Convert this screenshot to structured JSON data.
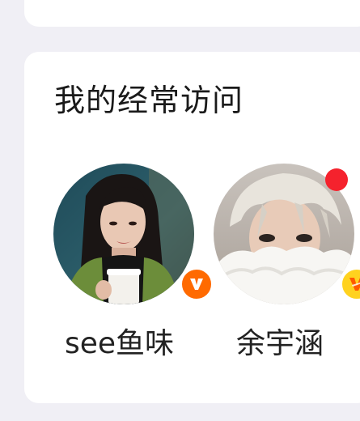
{
  "colors": {
    "page_bg": "#f0eff5",
    "card_bg": "#ffffff",
    "vip_orange": "#ff6a00",
    "vip_gold": "#ffd21f",
    "notification_red": "#f5222d"
  },
  "section": {
    "title": "我的经常访问",
    "items": [
      {
        "name": "see鱼味",
        "avatar": "avatar-woman-dark-hair-holding-cup",
        "badge": "vip-v-orange-icon",
        "has_unread_dot": false
      },
      {
        "name": "余宇涵",
        "avatar": "avatar-man-blond-hair-white-scarf",
        "badge": "vip-v-gold-icon",
        "has_unread_dot": true
      }
    ]
  }
}
